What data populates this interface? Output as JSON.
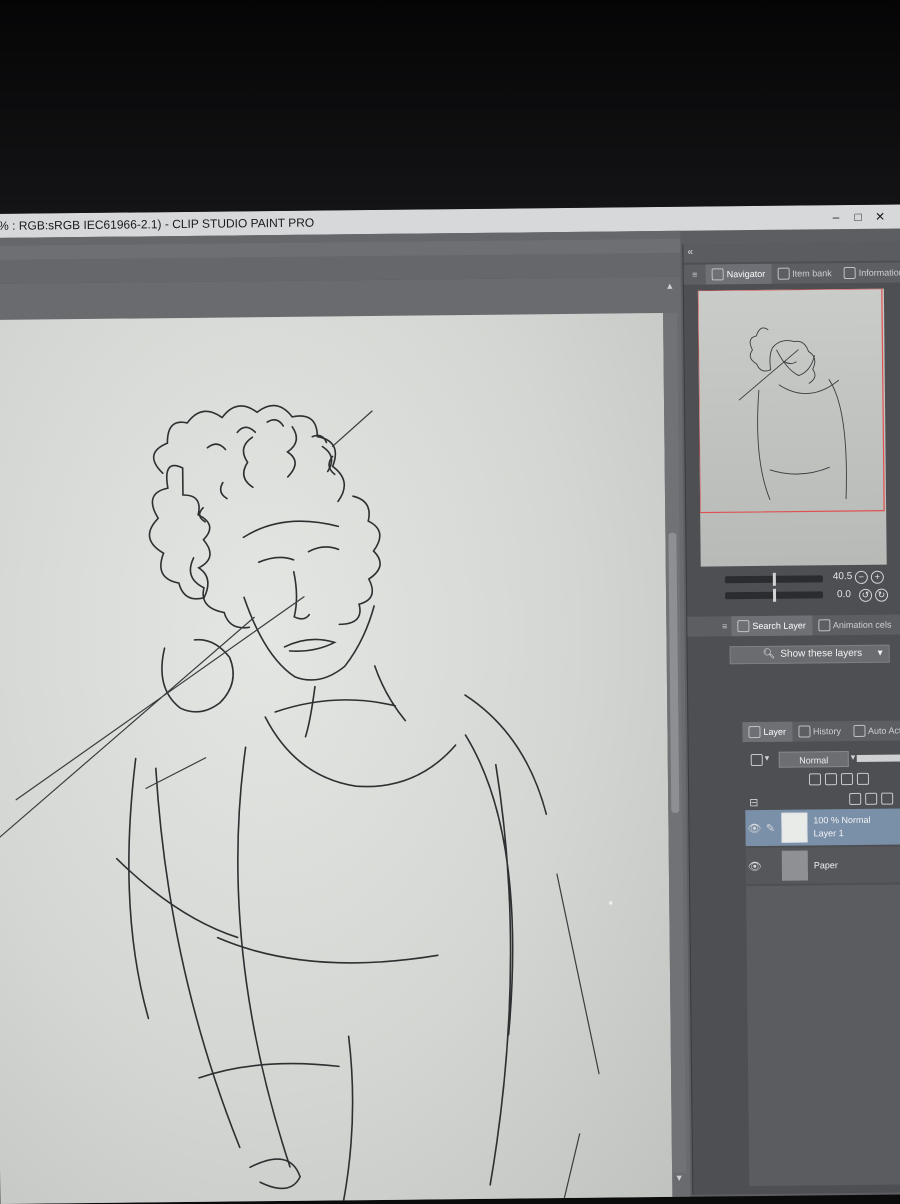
{
  "window": {
    "title": "% : RGB:sRGB IEC61966-2.1)  - CLIP STUDIO PAINT PRO",
    "controls": [
      "–",
      "□",
      "✕"
    ]
  },
  "panel": {
    "header_arrow": "«",
    "navigator_tabs": [
      {
        "label": "Navigator",
        "icon": "navigator-icon",
        "active": true
      },
      {
        "label": "Item bank",
        "icon": "item-bank-icon",
        "active": false
      },
      {
        "label": "Information",
        "icon": "info-icon",
        "active": false
      }
    ],
    "zoom_value": "40.5",
    "rotation_value": "0.0",
    "search_tabs": [
      {
        "label": "Search Layer",
        "icon": "search-layer-icon",
        "active": true
      },
      {
        "label": "Animation cels",
        "icon": "animation-icon",
        "active": false
      }
    ],
    "show_layers_label": "Show these layers",
    "layer_tabs": [
      {
        "label": "Layer",
        "icon": "layer-icon",
        "active": true
      },
      {
        "label": "History",
        "icon": "history-icon",
        "active": false
      },
      {
        "label": "Auto Action",
        "icon": "auto-action-icon",
        "active": false
      }
    ],
    "blend_mode": "Normal",
    "layers": [
      {
        "line1": "100 % Normal",
        "line2": "Layer 1",
        "selected": true
      },
      {
        "line1": "",
        "line2": "Paper",
        "selected": false
      }
    ]
  },
  "colors": {
    "selection": "#7a8fa8",
    "navigator_frame": "#e05050"
  }
}
